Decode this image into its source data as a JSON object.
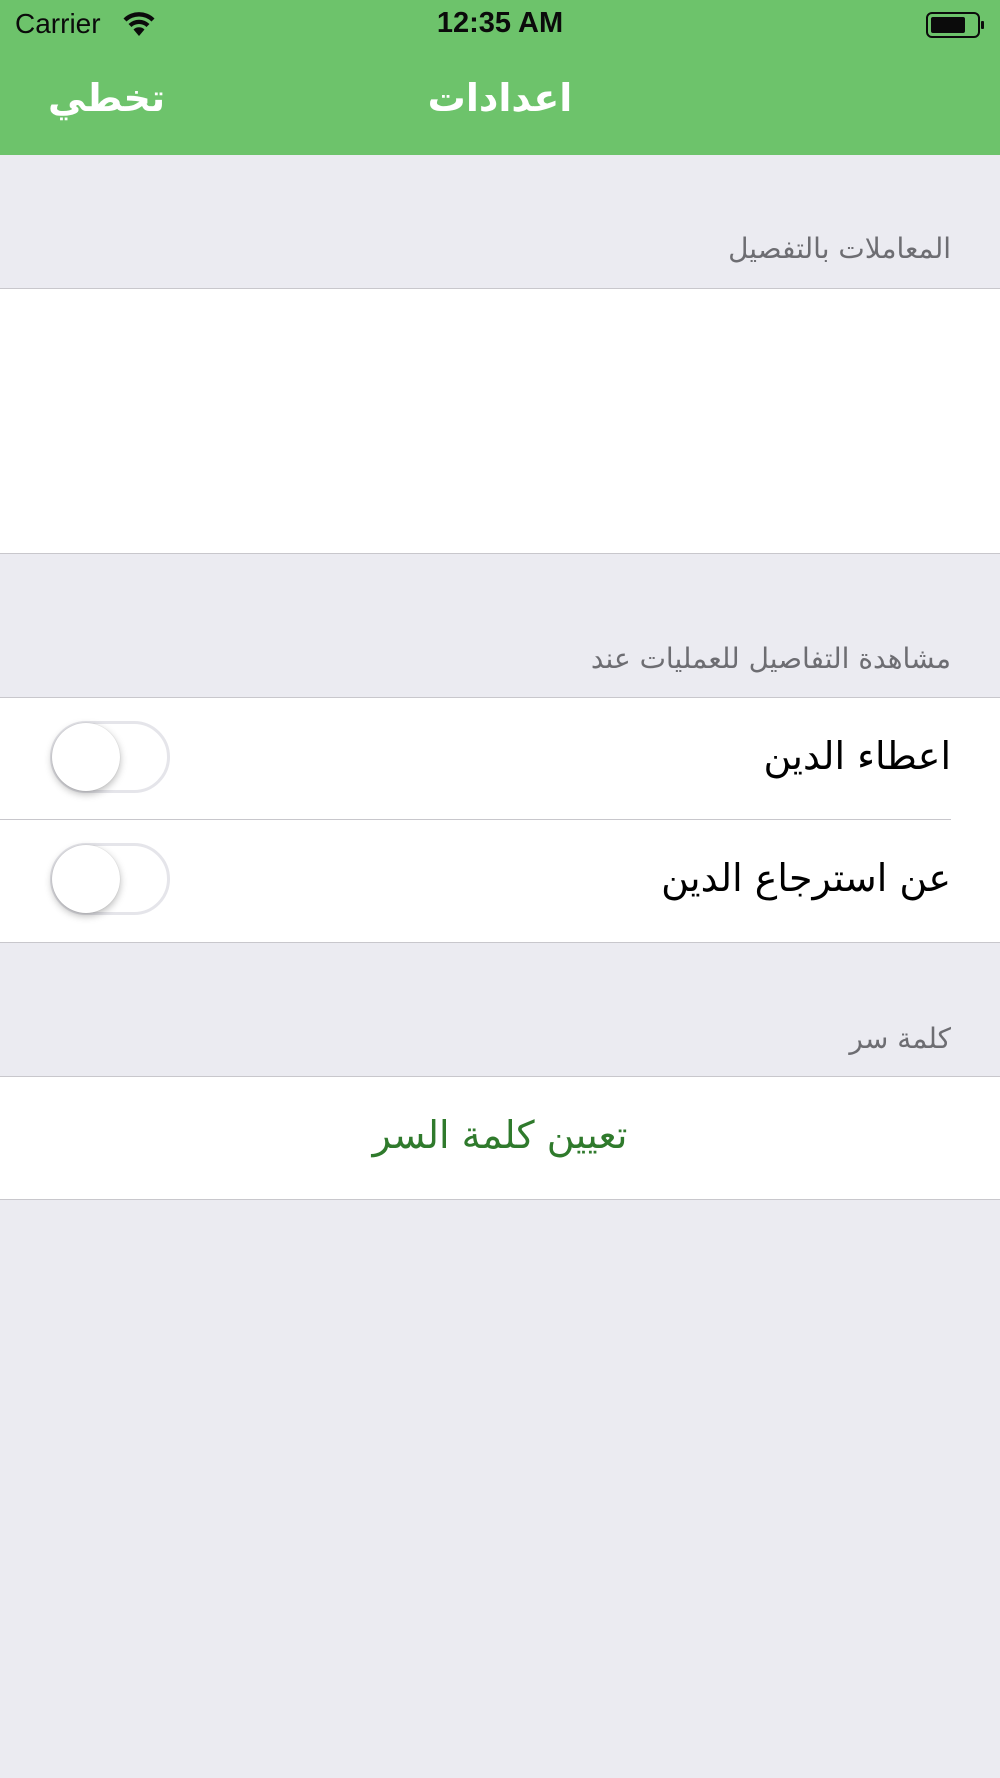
{
  "status_bar": {
    "carrier": "Carrier",
    "time": "12:35 AM",
    "icons": [
      "wifi-icon",
      "battery-icon"
    ]
  },
  "nav": {
    "title": "اعدادات",
    "skip_label": "تخطي",
    "background_color": "#6dc36b"
  },
  "sections": {
    "detailed_transactions": {
      "header": "المعاملات بالتفصيل"
    },
    "view_details": {
      "header": "مشاهدة التفاصيل للعمليات عند",
      "rows": [
        {
          "label": "اعطاء الدين",
          "toggle_on": false
        },
        {
          "label": "عن استرجاع الدين",
          "toggle_on": false
        }
      ]
    },
    "password": {
      "header": "كلمة سر",
      "action_label": "تعيين كلمة السر",
      "action_color": "#2f7a2c"
    }
  }
}
